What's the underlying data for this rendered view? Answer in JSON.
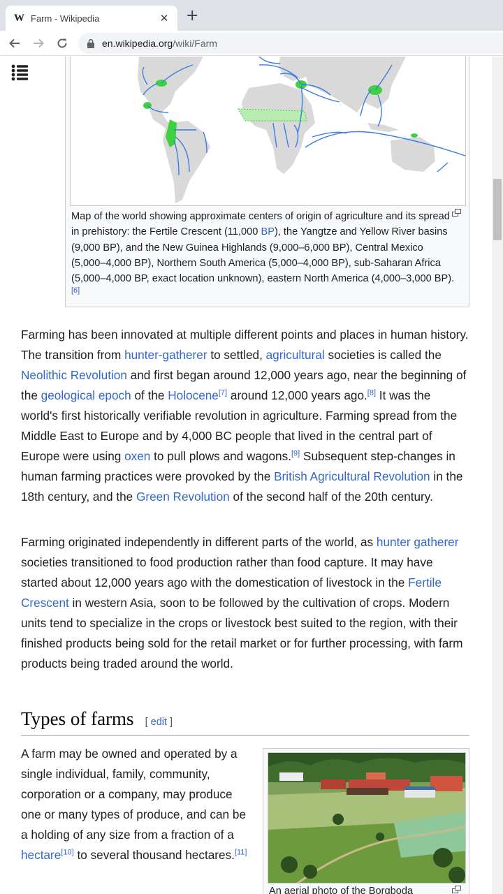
{
  "browser": {
    "tab": {
      "favicon": "W",
      "title": "Farm - Wikipedia",
      "close": "✕"
    },
    "new_tab": "+",
    "url_host": "en.wikipedia.org",
    "url_path": "/wiki/Farm",
    "icons": [
      "back-arrow-icon",
      "forward-arrow-icon",
      "reload-icon",
      "lock-icon"
    ]
  },
  "figure_map": {
    "caption_parts": {
      "p1": "Map of the world showing approximate centers of origin of agriculture and its spread in prehistory: the Fertile Crescent (11,000 ",
      "bp_link": "BP",
      "p2": "), the Yangtze and Yellow River basins (9,000 BP), and the New Guinea Highlands (9,000–6,000 BP), Central Mexico (5,000–4,000 BP), Northern South America (5,000–4,000 BP), sub-Saharan Africa (5,000–4,000 BP, exact location unknown), eastern North America (4,000–3,000 BP).",
      "ref": "[6]"
    },
    "colors": {
      "land": "#d9d9d9",
      "origin": "#3fd13f",
      "arrow": "#3a7ee0"
    }
  },
  "para1": {
    "t1": "Farming has been innovated at multiple different points and places in human history. The transition from ",
    "l1": "hunter-gatherer",
    "t2": " to settled, ",
    "l2": "agricultural",
    "t3": " societies is called the ",
    "l3": "Neolithic Revolution",
    "t4": " and first began around 12,000 years ago, near the beginning of the ",
    "l4": "geological epoch",
    "t5": " of the ",
    "l5": "Holocene",
    "r7": "[7]",
    "t6": " around 12,000 years ago.",
    "r8": "[8]",
    "t7": " It was the world's first historically verifiable revolution in agriculture. Farming spread from the Middle East to Europe and by 4,000 BC people that lived in the central part of Europe were using ",
    "l6": "oxen",
    "t8": " to pull plows and wagons.",
    "r9": "[9]",
    "t9": " Subsequent step-changes in human farming practices were provoked by the ",
    "l7": "British Agricultural Revolution",
    "t10": " in the 18th century, and the ",
    "l8": "Green Revolution",
    "t11": " of the second half of the 20th century."
  },
  "para2": {
    "t1": "Farming originated independently in different parts of the world, as ",
    "l1": "hunter gatherer",
    "t2": " societies transitioned to food production rather than food capture. It may have started about 12,000 years ago with the domestication of livestock in the ",
    "l2": "Fertile Crescent",
    "t3": " in western Asia, soon to be followed by the cultivation of crops. Modern units tend to specialize in the crops or livestock best suited to the region, with their finished products being sold for the retail market or for further processing, with farm products being traded around the world."
  },
  "section": {
    "title": "Types of farms",
    "edit_open": "[ ",
    "edit": "edit",
    "edit_close": " ]"
  },
  "para3": {
    "t1": "A farm may be owned and operated by a single individual, family, community, corporation or a company, may produce one or many types of produce, and can be a holding of any size from a fraction of a ",
    "l1": "hectare",
    "r10": "[10]",
    "t2": " to several thousand hectares.",
    "r11": "[11]"
  },
  "figure_farm": {
    "caption": "An aerial photo of the Borgboda"
  }
}
